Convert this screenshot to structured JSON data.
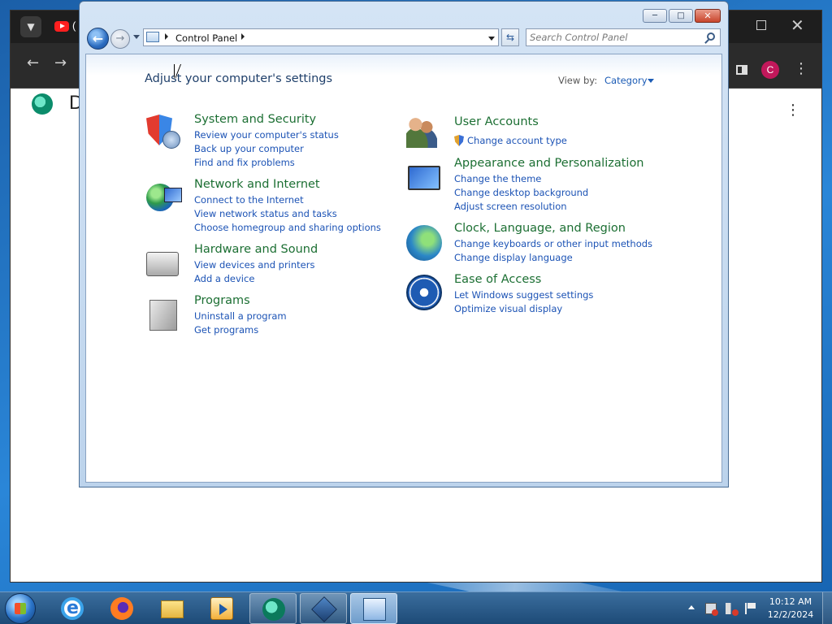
{
  "background_window": {
    "tab_fragment": "(",
    "page_letter": "D",
    "profile_initial": "C"
  },
  "control_panel": {
    "breadcrumb": "Control Panel",
    "search_placeholder": "Search Control Panel",
    "heading": "Adjust your computer's settings",
    "view_by_label": "View by:",
    "view_by_value": "Category",
    "left_categories": [
      {
        "title": "System and Security",
        "icon": "shield-icon",
        "links": [
          "Review your computer's status",
          "Back up your computer",
          "Find and fix problems"
        ]
      },
      {
        "title": "Network and Internet",
        "icon": "network-globe-icon",
        "links": [
          "Connect to the Internet",
          "View network status and tasks",
          "Choose homegroup and sharing options"
        ]
      },
      {
        "title": "Hardware and Sound",
        "icon": "printer-icon",
        "links": [
          "View devices and printers",
          "Add a device"
        ]
      },
      {
        "title": "Programs",
        "icon": "programs-box-icon",
        "links": [
          "Uninstall a program",
          "Get programs"
        ]
      }
    ],
    "right_categories": [
      {
        "title": "User Accounts",
        "icon": "users-icon",
        "links": [
          "Change account type"
        ]
      },
      {
        "title": "Appearance and Personalization",
        "icon": "monitor-paint-icon",
        "links": [
          "Change the theme",
          "Change desktop background",
          "Adjust screen resolution"
        ]
      },
      {
        "title": "Clock, Language, and Region",
        "icon": "clock-globe-icon",
        "links": [
          "Change keyboards or other input methods",
          "Change display language"
        ]
      },
      {
        "title": "Ease of Access",
        "icon": "ease-of-access-icon",
        "links": [
          "Let Windows suggest settings",
          "Optimize visual display"
        ]
      }
    ]
  },
  "taskbar": {
    "apps": [
      "internet-explorer-icon",
      "firefox-icon",
      "file-explorer-icon",
      "media-player-icon",
      "edge-icon",
      "virtualbox-icon",
      "control-panel-icon"
    ],
    "time": "10:12 AM",
    "date": "12/2/2024"
  },
  "colors": {
    "category_title": "#1c6f33",
    "link": "#1c53b5",
    "heading": "#1e3f6a"
  }
}
